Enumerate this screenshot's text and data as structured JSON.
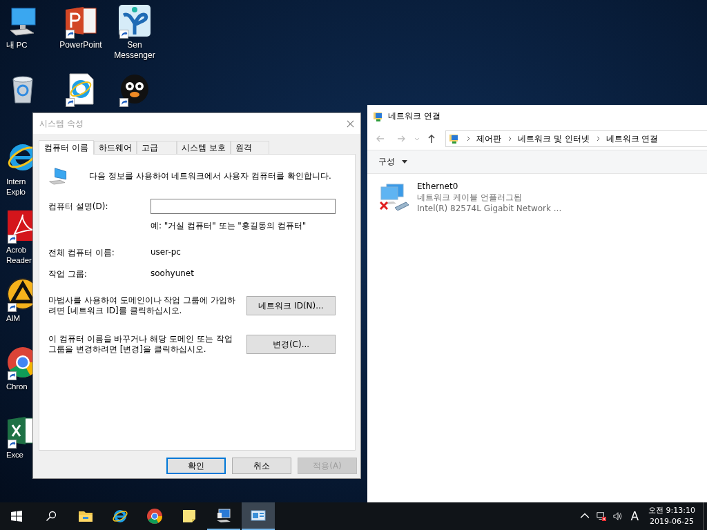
{
  "desktop_columns": [
    [
      {
        "kind": "pc",
        "shortcut": false,
        "label_lines": [
          "내 PC"
        ]
      },
      {
        "kind": "recycle",
        "shortcut": false
      },
      {
        "kind": "ie",
        "shortcut": false,
        "label_lines": [
          "Intern",
          "Explo"
        ]
      },
      {
        "kind": "acrobat",
        "shortcut": true,
        "label_lines": [
          "Acrob",
          "Reader"
        ]
      },
      {
        "kind": "aimp",
        "shortcut": true,
        "label_lines": [
          "AIM"
        ]
      },
      {
        "kind": "chrome",
        "shortcut": true,
        "label_lines": [
          "Chron"
        ]
      },
      {
        "kind": "excel",
        "shortcut": true,
        "label_lines": [
          "Exce"
        ]
      }
    ],
    [
      {
        "kind": "powerpoint",
        "shortcut": true,
        "label_lines": [
          "PowerPoint"
        ]
      },
      {
        "kind": "ie-doc",
        "shortcut": true
      }
    ],
    [
      {
        "kind": "messenger",
        "shortcut": true,
        "label_lines": [
          "Sen",
          "Messenger"
        ]
      },
      {
        "kind": "penguin",
        "shortcut": true
      }
    ]
  ],
  "system_properties": {
    "title": "시스템 속성",
    "tabs": [
      {
        "label": "컴퓨터 이름",
        "selected": true
      },
      {
        "label": "하드웨어",
        "selected": false
      },
      {
        "label": "고급",
        "selected": false
      },
      {
        "label": "시스템 보호",
        "selected": false
      },
      {
        "label": "원격",
        "selected": false
      }
    ],
    "intro": "다음 정보를 사용하여 네트워크에서 사용자 컴퓨터를 확인합니다.",
    "description_label": "컴퓨터 설명(D):",
    "example": "예: \"거실 컴퓨터\" 또는 \"홍길동의 컴퓨터\"",
    "info_rows": [
      {
        "label": "전체 컴퓨터 이름:",
        "value": "user-pc"
      },
      {
        "label": "작업 그룹:",
        "value": "soohyunet"
      }
    ],
    "actions": [
      {
        "text": "마법사를 사용하여 도메인이나 작업 그룹에 가입하려면 [네트워크 ID]를 클릭하십시오.",
        "button": "네트워크 ID(N)..."
      },
      {
        "text": "이 컴퓨터 이름을 바꾸거나 해당 도메인 또는 작업 그룹을 변경하려면 [변경]을 클릭하십시오.",
        "button": "변경(C)..."
      }
    ],
    "buttons": [
      {
        "label": "확인",
        "default": true,
        "disabled": false
      },
      {
        "label": "취소",
        "default": false,
        "disabled": false
      },
      {
        "label": "적용(A)",
        "default": false,
        "disabled": true
      }
    ]
  },
  "network_window": {
    "title": "네트워크 연결",
    "breadcrumb": [
      "제어판",
      "네트워크 및 인터넷",
      "네트워크 연결"
    ],
    "command": "구성",
    "connections": [
      {
        "name": "Ethernet0",
        "status": "네트워크 케이블 언플러그됨",
        "device": "Intel(R) 82574L Gigabit Network ...",
        "disconnected": true
      }
    ]
  },
  "taskbar": {
    "apps": [
      {
        "kind": "explorer",
        "running": false,
        "active": false
      },
      {
        "kind": "ie",
        "running": false,
        "active": false
      },
      {
        "kind": "chrome",
        "running": false,
        "active": false
      },
      {
        "kind": "sticky",
        "running": false,
        "active": false
      },
      {
        "kind": "system",
        "running": true,
        "active": false
      },
      {
        "kind": "network",
        "running": true,
        "active": true
      }
    ],
    "ime": "A",
    "time": "오전 9:13:10",
    "date": "2019-06-25"
  }
}
